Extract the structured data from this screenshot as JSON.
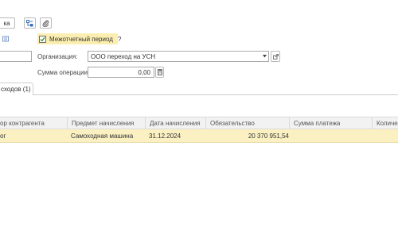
{
  "toolbar": {
    "first_button_label": "ка",
    "icons": [
      "tree-grid-icon",
      "paperclip-icon"
    ]
  },
  "header": {
    "intercompany_checkbox": {
      "label": "Межотчетный период",
      "checked": true,
      "help": "?"
    },
    "organization": {
      "label": "Организация:",
      "value": "ООО переход на УСН"
    },
    "amount": {
      "label": "Сумма операции:",
      "value": "0,00"
    }
  },
  "tabs": [
    {
      "label": "сходов (1)",
      "active": true
    }
  ],
  "table": {
    "columns": [
      "ор контрагента",
      "Предмет начисления",
      "Дата начисления",
      "Обязательство",
      "Сумма платежа",
      "Количе"
    ],
    "rows": [
      {
        "cells": [
          "ог",
          "Самоходная машина",
          "31.12.2024",
          "20 370 951,54",
          "",
          ""
        ],
        "selected": true
      }
    ]
  },
  "colors": {
    "selected_row": "#fbf0c2",
    "checkbox_highlight": "#fbeeb0",
    "header_bg": "#f2f2f2"
  }
}
